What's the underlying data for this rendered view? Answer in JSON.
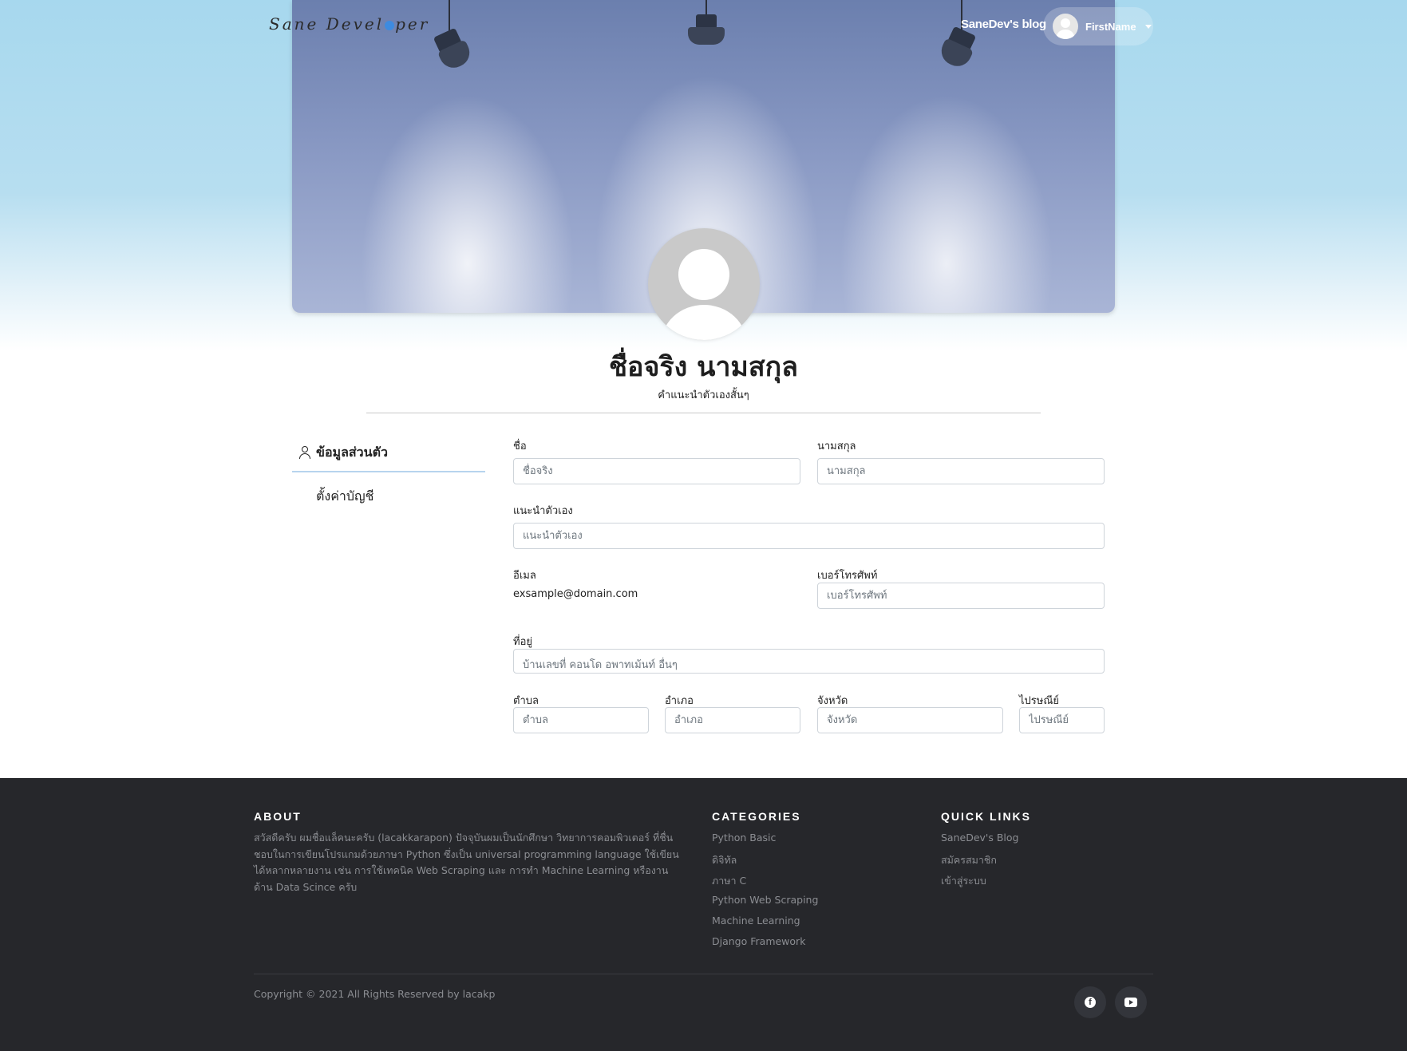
{
  "header": {
    "logo_text": "Sane Devel",
    "logo_text_end": "per",
    "brand_link": "SaneDev's blog",
    "user_name": "FirstName"
  },
  "profile": {
    "full_name": "ชื่อจริง นามสกุล",
    "short_bio": "คำแนะนำตัวเองสั้นๆ"
  },
  "sidebar": {
    "active_tab": "ข้อมูลส่วนตัว",
    "settings_tab": "ตั้งค่าบัญชี"
  },
  "form": {
    "first_name": {
      "label": "ชื่อ",
      "placeholder": "ชื่อจริง",
      "value": ""
    },
    "last_name": {
      "label": "นามสกุล",
      "placeholder": "นามสกุล",
      "value": ""
    },
    "bio": {
      "label": "แนะนำตัวเอง",
      "placeholder": "แนะนำตัวเอง",
      "value": ""
    },
    "email": {
      "label": "อีเมล",
      "value": "exsample@domain.com"
    },
    "phone": {
      "label": "เบอร์โทรศัพท์",
      "placeholder": "เบอร์โทรศัพท์",
      "value": ""
    },
    "address": {
      "label": "ที่อยู่",
      "placeholder": "บ้านเลขที่ คอนโด อพาทเม้นท์ อื่นๆ",
      "value": ""
    },
    "subdistrict": {
      "label": "ตำบล",
      "placeholder": "ตำบล",
      "value": ""
    },
    "district": {
      "label": "อำเภอ",
      "placeholder": "อำเภอ",
      "value": ""
    },
    "province": {
      "label": "จังหวัด",
      "placeholder": "จังหวัด",
      "value": ""
    },
    "postal_code": {
      "label": "ไปรษณีย์",
      "placeholder": "ไปรษณีย์",
      "value": ""
    }
  },
  "footer": {
    "about_title": "ABOUT",
    "about_text": "สวัสดีครับ ผมชื่อแล็คนะครับ (lacakkarapon) ปัจจุบันผมเป็นนักศึกษา วิทยาการคอมพิวเตอร์ ที่ชื่นชอบในการเขียนโปรแกมด้วยภาษา Python ซึ่งเป็น universal programming language ใช้เขียนได้หลากหลายงาน เช่น การใช้เทคนิค Web Scraping และ การทำ Machine Learning หรืองานด้าน Data Scince ครับ",
    "categories_title": "CATEGORIES",
    "categories": [
      "Python Basic",
      "ดิจิทัล",
      "ภาษา C",
      "Python Web Scraping",
      "Machine Learning",
      "Django Framework"
    ],
    "quick_links_title": "QUICK LINKS",
    "quick_links": [
      "SaneDev's Blog",
      "สมัครสมาชิก",
      "เข้าสู่ระบบ"
    ],
    "copyright": "Copyright © 2021 All Rights Reserved by lacakp"
  },
  "icons": {
    "facebook": "facebook-icon",
    "youtube": "youtube-icon"
  }
}
